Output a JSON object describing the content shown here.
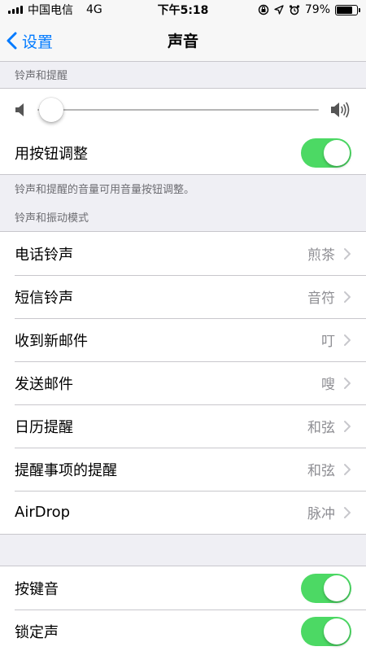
{
  "status_bar": {
    "carrier": "中国电信",
    "network": "4G",
    "time": "下午5:18",
    "battery": "79%",
    "battery_level": 0.79
  },
  "nav": {
    "back_label": "设置",
    "title": "声音"
  },
  "ringer": {
    "header": "铃声和提醒",
    "volume_level": 0.05,
    "change_with_buttons_label": "用按钮调整",
    "change_with_buttons_on": true,
    "footer": "铃声和提醒的音量可用音量按钮调整。"
  },
  "patterns": {
    "header": "铃声和振动模式",
    "items": [
      {
        "label": "电话铃声",
        "value": "煎茶"
      },
      {
        "label": "短信铃声",
        "value": "音符"
      },
      {
        "label": "收到新邮件",
        "value": "叮"
      },
      {
        "label": "发送邮件",
        "value": "嗖"
      },
      {
        "label": "日历提醒",
        "value": "和弦"
      },
      {
        "label": "提醒事项的提醒",
        "value": "和弦"
      },
      {
        "label": "AirDrop",
        "value": "脉冲"
      }
    ]
  },
  "other": {
    "items": [
      {
        "label": "按键音",
        "on": true
      },
      {
        "label": "锁定声",
        "on": true
      }
    ]
  },
  "colors": {
    "accent": "#007aff",
    "toggle_on": "#4cd964"
  }
}
